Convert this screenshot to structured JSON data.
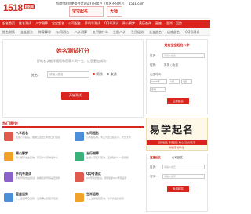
{
  "header": {
    "logo_text": "1518",
    "logo_badge": "起名网",
    "tagline": "您是第8位使用姓名测试打分用户（排名不分先后） 1518.com",
    "promo1": "宝宝起名",
    "promo2": "大师"
  },
  "topnav": [
    "起名首页",
    "姓名测试",
    "八字测算",
    "宝宝起名",
    "公司起名",
    "手机号测试",
    "QQ号测试",
    "周公解梦",
    "黄历查询",
    "星座",
    "生肖",
    "运势"
  ],
  "subnav": [
    "姓名测试",
    "宝宝起名",
    "称骨算命",
    "公司测名",
    "八字测算",
    "五行缺什么",
    "生辰八字",
    "生日运势",
    "宝宝起名",
    "店铺起名",
    "QQ号测试"
  ],
  "hero": {
    "title": "姓名测试打分",
    "description": "好的名字能伴随您和您家人的一生，让您更加成功！",
    "name_label": "姓名：",
    "name_placeholder": "请输入姓名",
    "gender_male": "男孩",
    "gender_female": "女孩",
    "submit": "开始测试"
  },
  "sidebar": {
    "title": "姓名宝宝起名八字",
    "surname_label": "姓氏：",
    "surname_placeholder": "请输入姓氏",
    "gender_label": "性别：",
    "gender_value": "男孩 ○女孩",
    "birth_label": "出生时间：",
    "birth_year": "1990年",
    "birth_month": "1月",
    "birth_day": "1日",
    "birth_hour": "子时",
    "submit": "立即起名"
  },
  "services_heading": "热门服务",
  "services": [
    {
      "title": "八字起名",
      "desc": "生辰八字起名，根据宝宝出生时辰五行起名",
      "color": "#e05a4f"
    },
    {
      "title": "公司起名",
      "desc": "公司起名网，专业为企业起名字，大吉大利",
      "color": "#4a8fd8"
    },
    {
      "title": "周公解梦",
      "desc": "周公解梦大全查询，梦见什么意味着什么",
      "color": "#f0a22a"
    },
    {
      "title": "五行测算",
      "desc": "生辰八字五行查询，五行缺什么一查便知",
      "color": "#3bb07a"
    },
    {
      "title": "手机号测试",
      "desc": "手机号码吉凶测试，看看您的号码是否吉利",
      "color": "#8a62c9"
    },
    {
      "title": "QQ号测试",
      "desc": "QQ号码测吉凶，测测您的QQ号码运势",
      "color": "#e05a4f"
    },
    {
      "title": "星座运势",
      "desc": "十二星座每日运势，爱情事业财运早知道",
      "color": "#4a8fd8"
    },
    {
      "title": "生肖运势",
      "desc": "十二生肖运势查询，今年的运势如何",
      "color": "#f0a22a"
    }
  ],
  "banner": {
    "big_text": "易学起名",
    "strip": "百家起名 专家起名 精心打造好名字",
    "foot": "好名字 好人生"
  },
  "side2": {
    "tab1": "宝宝起名",
    "tab2": "公司起名",
    "surname_label": "姓氏：",
    "surname_placeholder": "请输入姓氏",
    "name_label": "名字：",
    "name_placeholder": "请输入名字",
    "submit": "免费起名"
  }
}
